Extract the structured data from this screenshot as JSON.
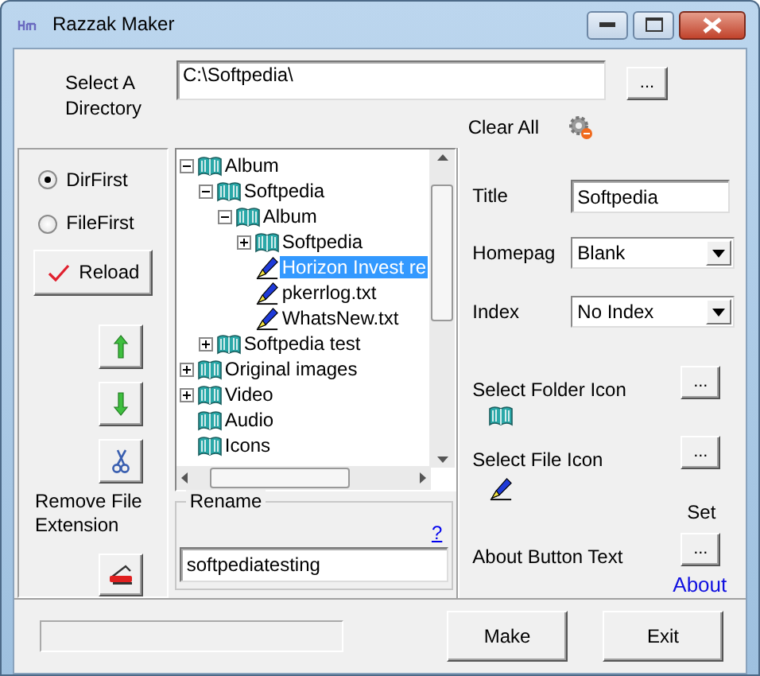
{
  "window": {
    "title": "Razzak Maker"
  },
  "directory": {
    "label": "Select A Directory",
    "value": "C:\\Softpedia\\",
    "browse": "...",
    "clear_all": "Clear All"
  },
  "order_options": [
    {
      "label": "DirFirst",
      "selected": true
    },
    {
      "label": "FileFirst",
      "selected": false
    }
  ],
  "reload_button": "Reload",
  "remove_extension_label": "Remove File Extension",
  "tree": {
    "items": [
      {
        "kind": "folder",
        "label": "Album",
        "expanded": true,
        "children": [
          {
            "kind": "folder",
            "label": "Softpedia",
            "expanded": true,
            "children": [
              {
                "kind": "folder",
                "label": "Album",
                "expanded": true,
                "children": [
                  {
                    "kind": "folder",
                    "label": "Softpedia",
                    "expanded": false
                  },
                  {
                    "kind": "file",
                    "label": "Horizon Invest re",
                    "selected": true
                  },
                  {
                    "kind": "file",
                    "label": "pkerrlog.txt",
                    "selected": false
                  },
                  {
                    "kind": "file",
                    "label": "WhatsNew.txt",
                    "selected": false
                  }
                ]
              }
            ]
          },
          {
            "kind": "folder",
            "label": "Softpedia test",
            "expanded": false
          }
        ]
      },
      {
        "kind": "folder",
        "label": "Original images",
        "expanded": false
      },
      {
        "kind": "folder",
        "label": "Video",
        "expanded": false
      },
      {
        "kind": "folder",
        "label": "Audio"
      },
      {
        "kind": "folder",
        "label": "Icons"
      }
    ]
  },
  "rename": {
    "legend": "Rename",
    "help": "?",
    "value": "softpediatesting"
  },
  "settings": {
    "title_label": "Title",
    "title_value": "Softpedia",
    "homepage_label": "Homepag",
    "homepage_value": "Blank",
    "index_label": "Index",
    "index_value": "No Index",
    "folder_icon_label": "Select Folder Icon",
    "folder_icon_button": "...",
    "file_icon_label": "Select File Icon",
    "file_icon_button": "...",
    "set_label": "Set",
    "about_label": "About Button Text",
    "about_button": "...",
    "about_link": "About"
  },
  "progress": {
    "level": 0
  },
  "buttons": [
    "Make",
    "Exit"
  ]
}
